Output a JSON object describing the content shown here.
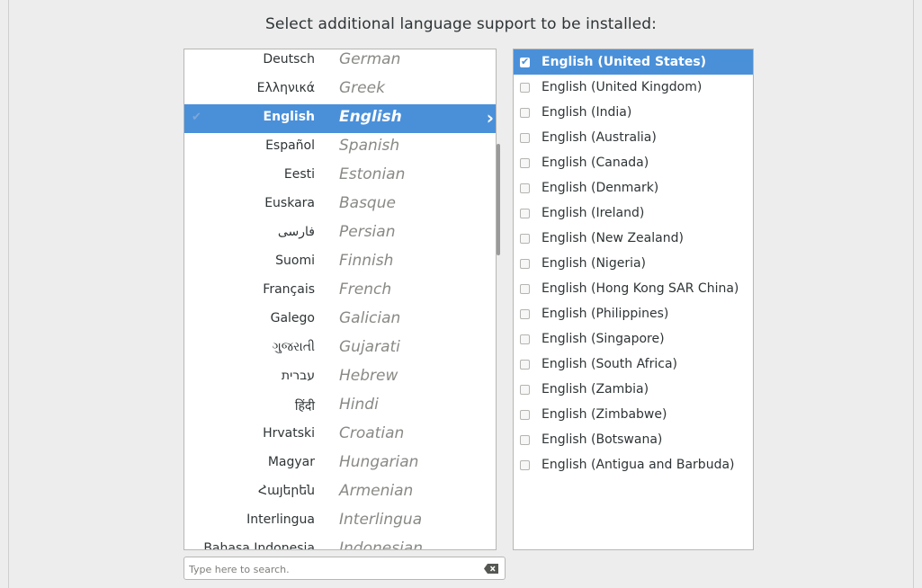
{
  "heading": "Select additional language support to be installed:",
  "languages": [
    {
      "native": "Deutsch",
      "english": "German"
    },
    {
      "native": "Ελληνικά",
      "english": "Greek"
    },
    {
      "native": "English",
      "english": "English"
    },
    {
      "native": "Español",
      "english": "Spanish"
    },
    {
      "native": "Eesti",
      "english": "Estonian"
    },
    {
      "native": "Euskara",
      "english": "Basque"
    },
    {
      "native": "فارسی",
      "english": "Persian"
    },
    {
      "native": "Suomi",
      "english": "Finnish"
    },
    {
      "native": "Français",
      "english": "French"
    },
    {
      "native": "Galego",
      "english": "Galician"
    },
    {
      "native": "ગુજરાતી",
      "english": "Gujarati"
    },
    {
      "native": "עברית",
      "english": "Hebrew"
    },
    {
      "native": "हिंदी",
      "english": "Hindi"
    },
    {
      "native": "Hrvatski",
      "english": "Croatian"
    },
    {
      "native": "Magyar",
      "english": "Hungarian"
    },
    {
      "native": "Հայերեն",
      "english": "Armenian"
    },
    {
      "native": "Interlingua",
      "english": "Interlingua"
    },
    {
      "native": "Bahasa Indonesia",
      "english": "Indonesian"
    }
  ],
  "selected_language": "English",
  "selected_language_check": "✔",
  "selected_language_chevron": "›",
  "locales": [
    {
      "label": "English (United States)",
      "checked": true
    },
    {
      "label": "English (United Kingdom)",
      "checked": false
    },
    {
      "label": "English (India)",
      "checked": false
    },
    {
      "label": "English (Australia)",
      "checked": false
    },
    {
      "label": "English (Canada)",
      "checked": false
    },
    {
      "label": "English (Denmark)",
      "checked": false
    },
    {
      "label": "English (Ireland)",
      "checked": false
    },
    {
      "label": "English (New Zealand)",
      "checked": false
    },
    {
      "label": "English (Nigeria)",
      "checked": false
    },
    {
      "label": "English (Hong Kong SAR China)",
      "checked": false
    },
    {
      "label": "English (Philippines)",
      "checked": false
    },
    {
      "label": "English (Singapore)",
      "checked": false
    },
    {
      "label": "English (South Africa)",
      "checked": false
    },
    {
      "label": "English (Zambia)",
      "checked": false
    },
    {
      "label": "English (Zimbabwe)",
      "checked": false
    },
    {
      "label": "English (Botswana)",
      "checked": false
    },
    {
      "label": "English (Antigua and Barbuda)",
      "checked": false
    }
  ],
  "checkbox_tick": "✔",
  "search": {
    "placeholder": "Type here to search.",
    "value": ""
  },
  "colors": {
    "accent": "#4a90d9",
    "background": "#ededed",
    "text": "#2e3436",
    "muted": "#888a85"
  },
  "icons": {
    "selected_check": "check-icon",
    "expand": "chevron-right-icon",
    "clear": "backspace-icon"
  }
}
